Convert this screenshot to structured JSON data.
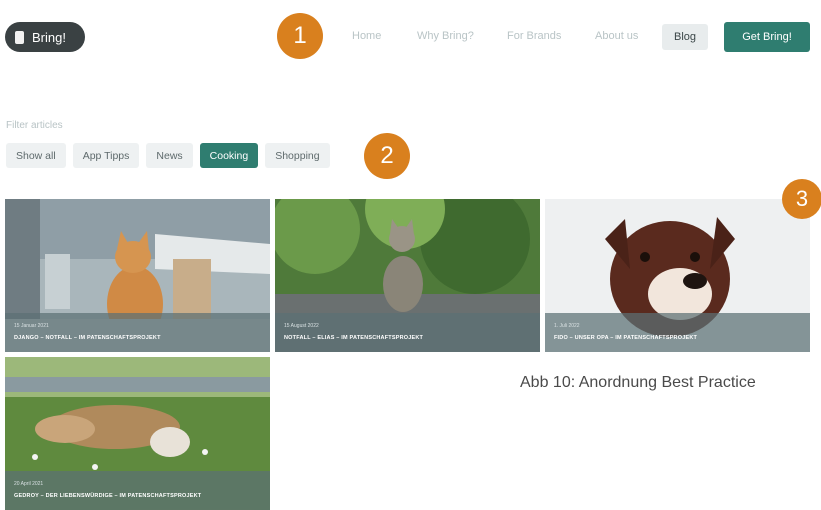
{
  "header": {
    "logo_text": "Bring!",
    "nav": [
      "Home",
      "Why Bring?",
      "For Brands",
      "About us"
    ],
    "blog_label": "Blog",
    "cta_label": "Get Bring!"
  },
  "markers": [
    "1",
    "2",
    "3"
  ],
  "filters": {
    "label": "Filter articles",
    "options": [
      "Show all",
      "App Tipps",
      "News",
      "Cooking",
      "Shopping"
    ],
    "active": "Cooking"
  },
  "cards": [
    {
      "date": "15 Januar 2021",
      "title": "DJANGO – NOTFALL – IM PATENSCHAFTSPROJEKT"
    },
    {
      "date": "15 August 2022",
      "title": "NOTFALL – ELIAS – IM PATENSCHAFTSPROJEKT"
    },
    {
      "date": "1. Juli 2022",
      "title": "FIDO – UNSER OPA – IM PATENSCHAFTSPROJEKT"
    },
    {
      "date": "20 April 2021",
      "title": "GEDROY – DER LIEBENSWÜRDIGE – IM PATENSCHAFTSPROJEKT"
    }
  ],
  "caption": "Abb 10: Anordnung Best Practice",
  "colors": {
    "accent": "#2f7d70",
    "marker": "#d9801e",
    "logo_bg": "#3a4143"
  }
}
